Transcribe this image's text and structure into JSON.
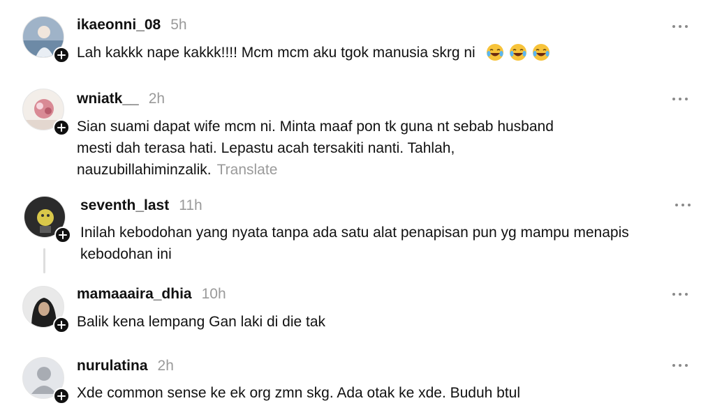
{
  "comments": [
    {
      "username": "ikaeonni_08",
      "time": "5h",
      "text": "Lah kakkk nape kakkk!!!! Mcm mcm aku tgok manusia skrg ni",
      "emojis": [
        "rolling-on-floor-laughing",
        "rolling-on-floor-laughing",
        "rolling-on-floor-laughing"
      ]
    },
    {
      "username": "wniatk__",
      "time": "2h",
      "text": "Sian suami dapat wife mcm ni. Minta maaf pon tk guna nt sebab husband mesti dah terasa hati. Lepastu acah tersakiti nanti. Tahlah, nauzubillahiminzalik.",
      "translate": "Translate"
    },
    {
      "username": "seventh_last",
      "time": "11h",
      "text": "Inilah kebodohan yang nyata tanpa ada satu alat penapisan pun yg mampu menapis kebodohan ini"
    },
    {
      "username": "mamaaaira_dhia",
      "time": "10h",
      "text": "Balik kena lempang Gan laki di die tak"
    },
    {
      "username": "nurulatina",
      "time": "2h",
      "text": "Xde common sense ke ek org zmn skg. Ada otak ke xde. Buduh btul"
    }
  ],
  "colors": {
    "text": "#111111",
    "muted": "#9a9a9a",
    "badge": "#111111",
    "thread_line": "#dedede"
  },
  "icons": {
    "follow": "plus-icon",
    "more": "more-horizontal-icon",
    "default_avatar": "default-user-icon"
  }
}
